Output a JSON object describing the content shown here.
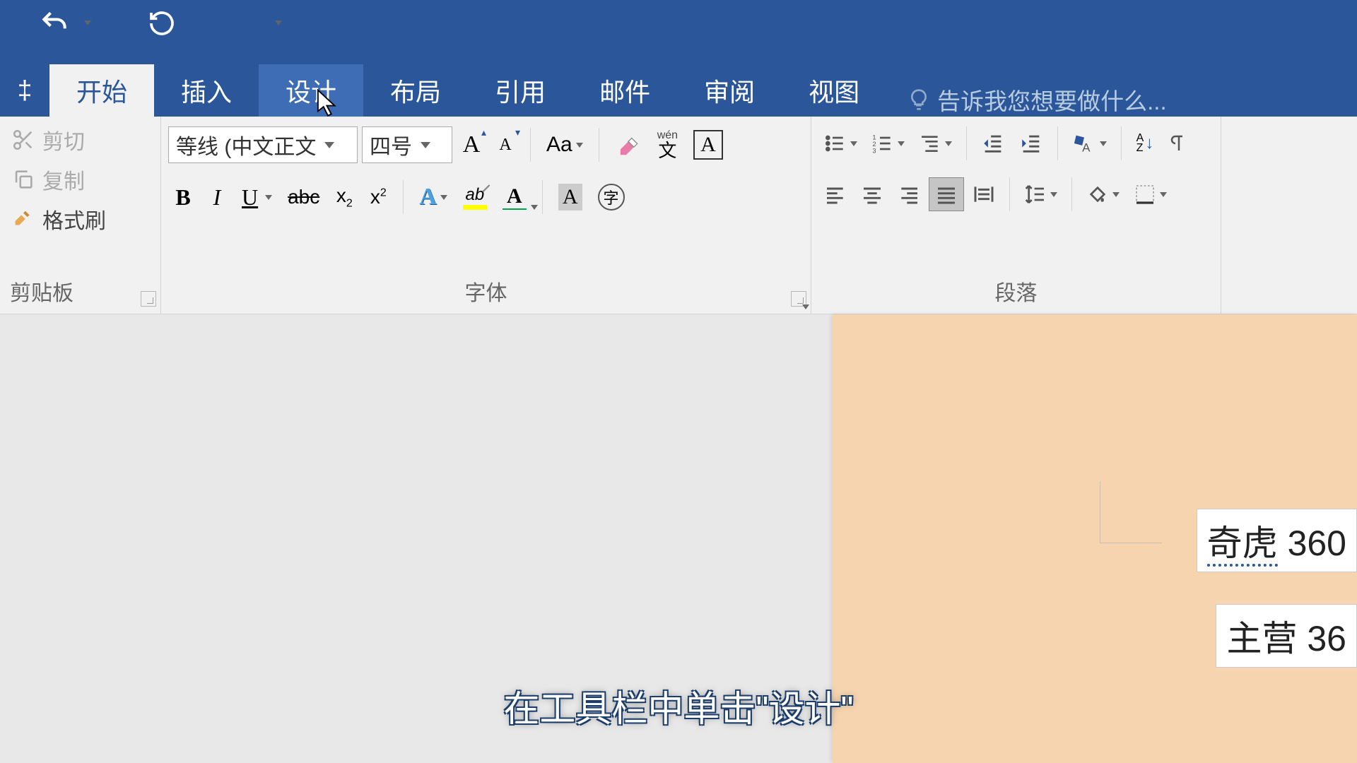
{
  "qat": {
    "undo": "↶",
    "redo": "↻"
  },
  "tabs": {
    "file_partial": "‡",
    "home": "开始",
    "insert": "插入",
    "design": "设计",
    "layout": "布局",
    "references": "引用",
    "mailings": "邮件",
    "review": "审阅",
    "view": "视图",
    "tell_me": "告诉我您想要做什么..."
  },
  "clipboard": {
    "cut": "剪切",
    "copy": "复制",
    "format_painter": "格式刷",
    "group_label": "剪贴板"
  },
  "font": {
    "font_name": "等线 (中文正文",
    "font_size": "四号",
    "group_label": "字体",
    "bold": "B",
    "italic": "I",
    "underline": "U",
    "strike": "abc",
    "sub": "x",
    "sub_sub": "2",
    "sup": "x",
    "sup_sup": "2",
    "aa": "Aa",
    "phonetic_top": "wén",
    "phonetic_bottom": "文",
    "char_border": "A",
    "big_a": "A",
    "small_a": "A",
    "effect_a": "A",
    "highlight_a": "ab",
    "color_a": "A",
    "shade_a": "A",
    "circle": "字"
  },
  "paragraph": {
    "group_label": "段落",
    "sort_top": "A",
    "sort_bottom": "Z"
  },
  "document": {
    "text1_a": "奇虎",
    "text1_b": " 360",
    "text2": "主营  36"
  },
  "caption": "在工具栏中单击\"设计\""
}
